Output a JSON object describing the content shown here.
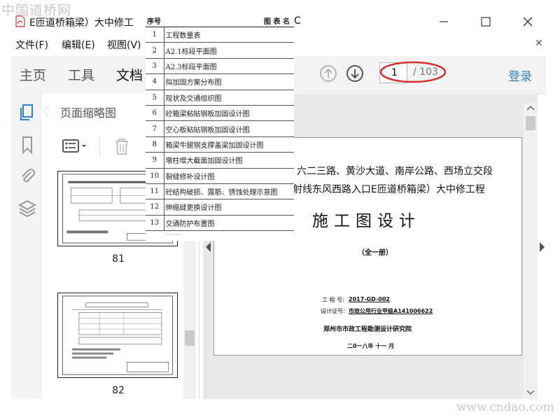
{
  "window": {
    "title": "E匝道桥箱梁）大中修工",
    "title_tail": "C"
  },
  "menu": {
    "items": [
      "文件(F)",
      "编辑(E)",
      "视图(V)"
    ]
  },
  "toolbar": {
    "tabs": [
      "主页",
      "工具",
      "文档"
    ],
    "current_page": "1",
    "total_pages": "/ 103",
    "login": "登录"
  },
  "sidebar": {
    "panel_title": "页面缩略图",
    "thumbnails": [
      {
        "page": "81"
      },
      {
        "page": "82"
      }
    ]
  },
  "drawing_list": {
    "headers": [
      "序号",
      "图 表 名"
    ],
    "rows": [
      {
        "no": "1",
        "name": "工程数量表"
      },
      {
        "no": "2",
        "name": "A2.1标段平面图"
      },
      {
        "no": "3",
        "name": "A2.3标段平面图"
      },
      {
        "no": "4",
        "name": "拟加固方案分布图"
      },
      {
        "no": "5",
        "name": "现状及交通组织图"
      },
      {
        "no": "6",
        "name": "砼箱梁粘贴钢板加固设计图"
      },
      {
        "no": "7",
        "name": "空心板粘贴钢板加固设计图"
      },
      {
        "no": "8",
        "name": "箱梁牛腿钢支撑盖梁加固设计图"
      },
      {
        "no": "9",
        "name": "墩柱增大截面加固设计图"
      },
      {
        "no": "10",
        "name": "裂缝修补设计图"
      },
      {
        "no": "11",
        "name": "砼结构破损、露筋、锈蚀处理示意图"
      },
      {
        "no": "12",
        "name": "伸缩缝更换设计图"
      },
      {
        "no": "13",
        "name": "交通防护布置图"
      }
    ]
  },
  "document": {
    "line1": "六二三路、黄沙大道、南岸公路、西场立交段",
    "line2": "射线东风西路入口E匝道桥箱梁）大中修工程",
    "heading": "施工图设计",
    "volume": "（全一册）",
    "project_label": "工 程 号:",
    "project_value": "2017-GD-002",
    "cert_label": "设计证号:",
    "cert_value": "市政公用行业甲级A141006622",
    "institute": "郑州市市政工程勘测设计研究院",
    "date": "二0一八年 十一 月"
  },
  "watermarks": {
    "top": "中国道桥网",
    "bottom": "www.cndao.com"
  },
  "colors": {
    "accent": "#2f7fd1",
    "annotation": "#d0312d"
  },
  "icons": [
    "pdf-icon",
    "minimize-icon",
    "maximize-icon",
    "close-icon",
    "arrow-up-icon",
    "arrow-down-icon",
    "pages-icon",
    "bookmark-icon",
    "paperclip-icon",
    "layers-icon",
    "list-options-icon",
    "trash-icon"
  ]
}
